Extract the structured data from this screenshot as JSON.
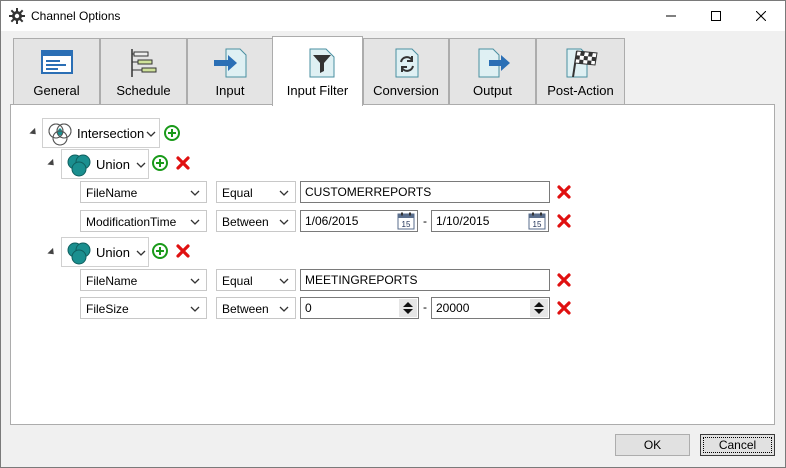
{
  "window": {
    "title": "Channel Options",
    "icon": "gear-icon"
  },
  "tabs": [
    {
      "label": "General",
      "icon": "window-icon"
    },
    {
      "label": "Schedule",
      "icon": "schedule-icon"
    },
    {
      "label": "Input",
      "icon": "input-arrow-icon"
    },
    {
      "label": "Input Filter",
      "icon": "funnel-icon",
      "active": true
    },
    {
      "label": "Conversion",
      "icon": "convert-icon"
    },
    {
      "label": "Output",
      "icon": "output-arrow-icon"
    },
    {
      "label": "Post-Action",
      "icon": "checkered-flag-icon"
    }
  ],
  "filter_tree": {
    "root": {
      "operator": "Intersection"
    },
    "groups": [
      {
        "operator": "Union",
        "conditions": [
          {
            "field": "FileName",
            "comparison": "Equal",
            "value": "CUSTOMERREPORTS"
          },
          {
            "field": "ModificationTime",
            "comparison": "Between",
            "from": "1/06/2015",
            "to": "1/10/2015",
            "calendar_day": "15"
          }
        ]
      },
      {
        "operator": "Union",
        "conditions": [
          {
            "field": "FileName",
            "comparison": "Equal",
            "value": "MEETINGREPORTS"
          },
          {
            "field": "FileSize",
            "comparison": "Between",
            "from": "0",
            "to": "20000"
          }
        ]
      }
    ],
    "range_separator": "-"
  },
  "buttons": {
    "ok": "OK",
    "cancel": "Cancel"
  },
  "colors": {
    "add_green": "#1a9a1a",
    "delete_red": "#e01010",
    "tab_bg": "#e4e4e4",
    "venn_teal": "#1a8f8f"
  }
}
